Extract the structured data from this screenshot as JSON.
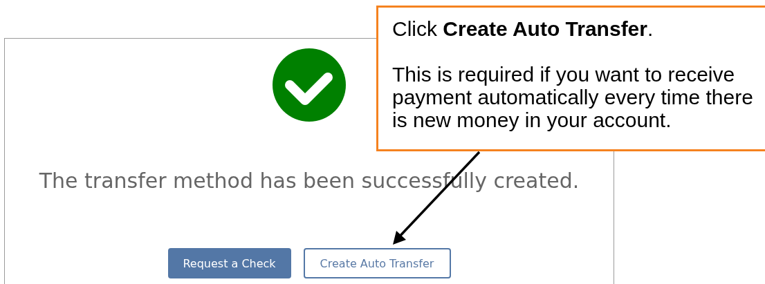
{
  "success_panel": {
    "message": "The transfer method has been successfully created.",
    "buttons": [
      {
        "label": "Request a Check",
        "kind": "primary"
      },
      {
        "label": "Create Auto Transfer",
        "kind": "outline"
      }
    ]
  },
  "callout": {
    "instruction": "Click **Create Auto Transfer**.",
    "note": "This is required if you want to receive payment automatically every time there is new money in your account."
  }
}
